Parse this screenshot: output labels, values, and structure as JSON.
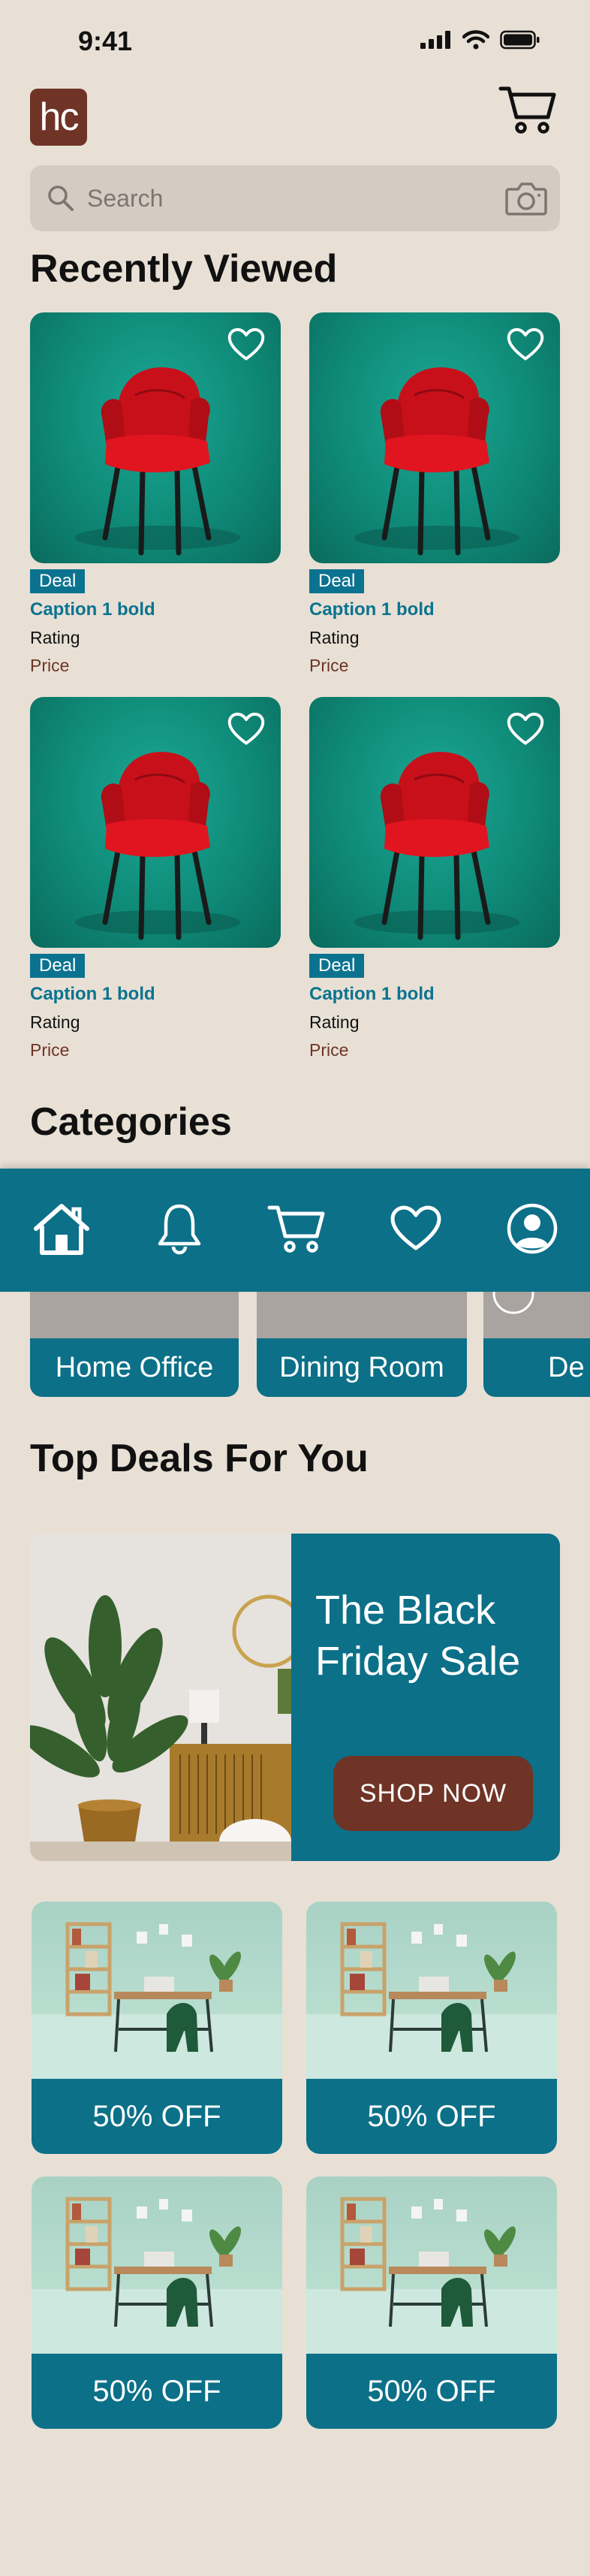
{
  "status_bar": {
    "time": "9:41"
  },
  "header": {
    "logo_text": "hc"
  },
  "search": {
    "placeholder": "Search"
  },
  "recently_viewed": {
    "title": "Recently Viewed",
    "items": [
      {
        "deal": "Deal",
        "caption": "Caption 1 bold",
        "rating": "Rating",
        "price": "Price"
      },
      {
        "deal": "Deal",
        "caption": "Caption 1 bold",
        "rating": "Rating",
        "price": "Price"
      },
      {
        "deal": "Deal",
        "caption": "Caption 1 bold",
        "rating": "Rating",
        "price": "Price"
      },
      {
        "deal": "Deal",
        "caption": "Caption 1 bold",
        "rating": "Rating",
        "price": "Price"
      }
    ]
  },
  "categories": {
    "title": "Categories",
    "items": [
      {
        "label": "Home Office"
      },
      {
        "label": "Dining Room"
      },
      {
        "label": "De"
      }
    ]
  },
  "tab_bar": {
    "icons": [
      "home-icon",
      "bell-icon",
      "cart-icon",
      "heart-icon",
      "profile-icon"
    ]
  },
  "top_deals": {
    "title": "Top Deals For You",
    "banner": {
      "title": "The Black Friday Sale",
      "button": "SHOP NOW"
    },
    "cards": [
      {
        "label": "50% OFF"
      },
      {
        "label": "50% OFF"
      },
      {
        "label": "50% OFF"
      },
      {
        "label": "50% OFF"
      }
    ]
  },
  "colors": {
    "background": "#e8e0d5",
    "teal": "#0b7088",
    "brown": "#6f3426",
    "product_bg": "#0f8a78",
    "chair": "#d4121b"
  }
}
